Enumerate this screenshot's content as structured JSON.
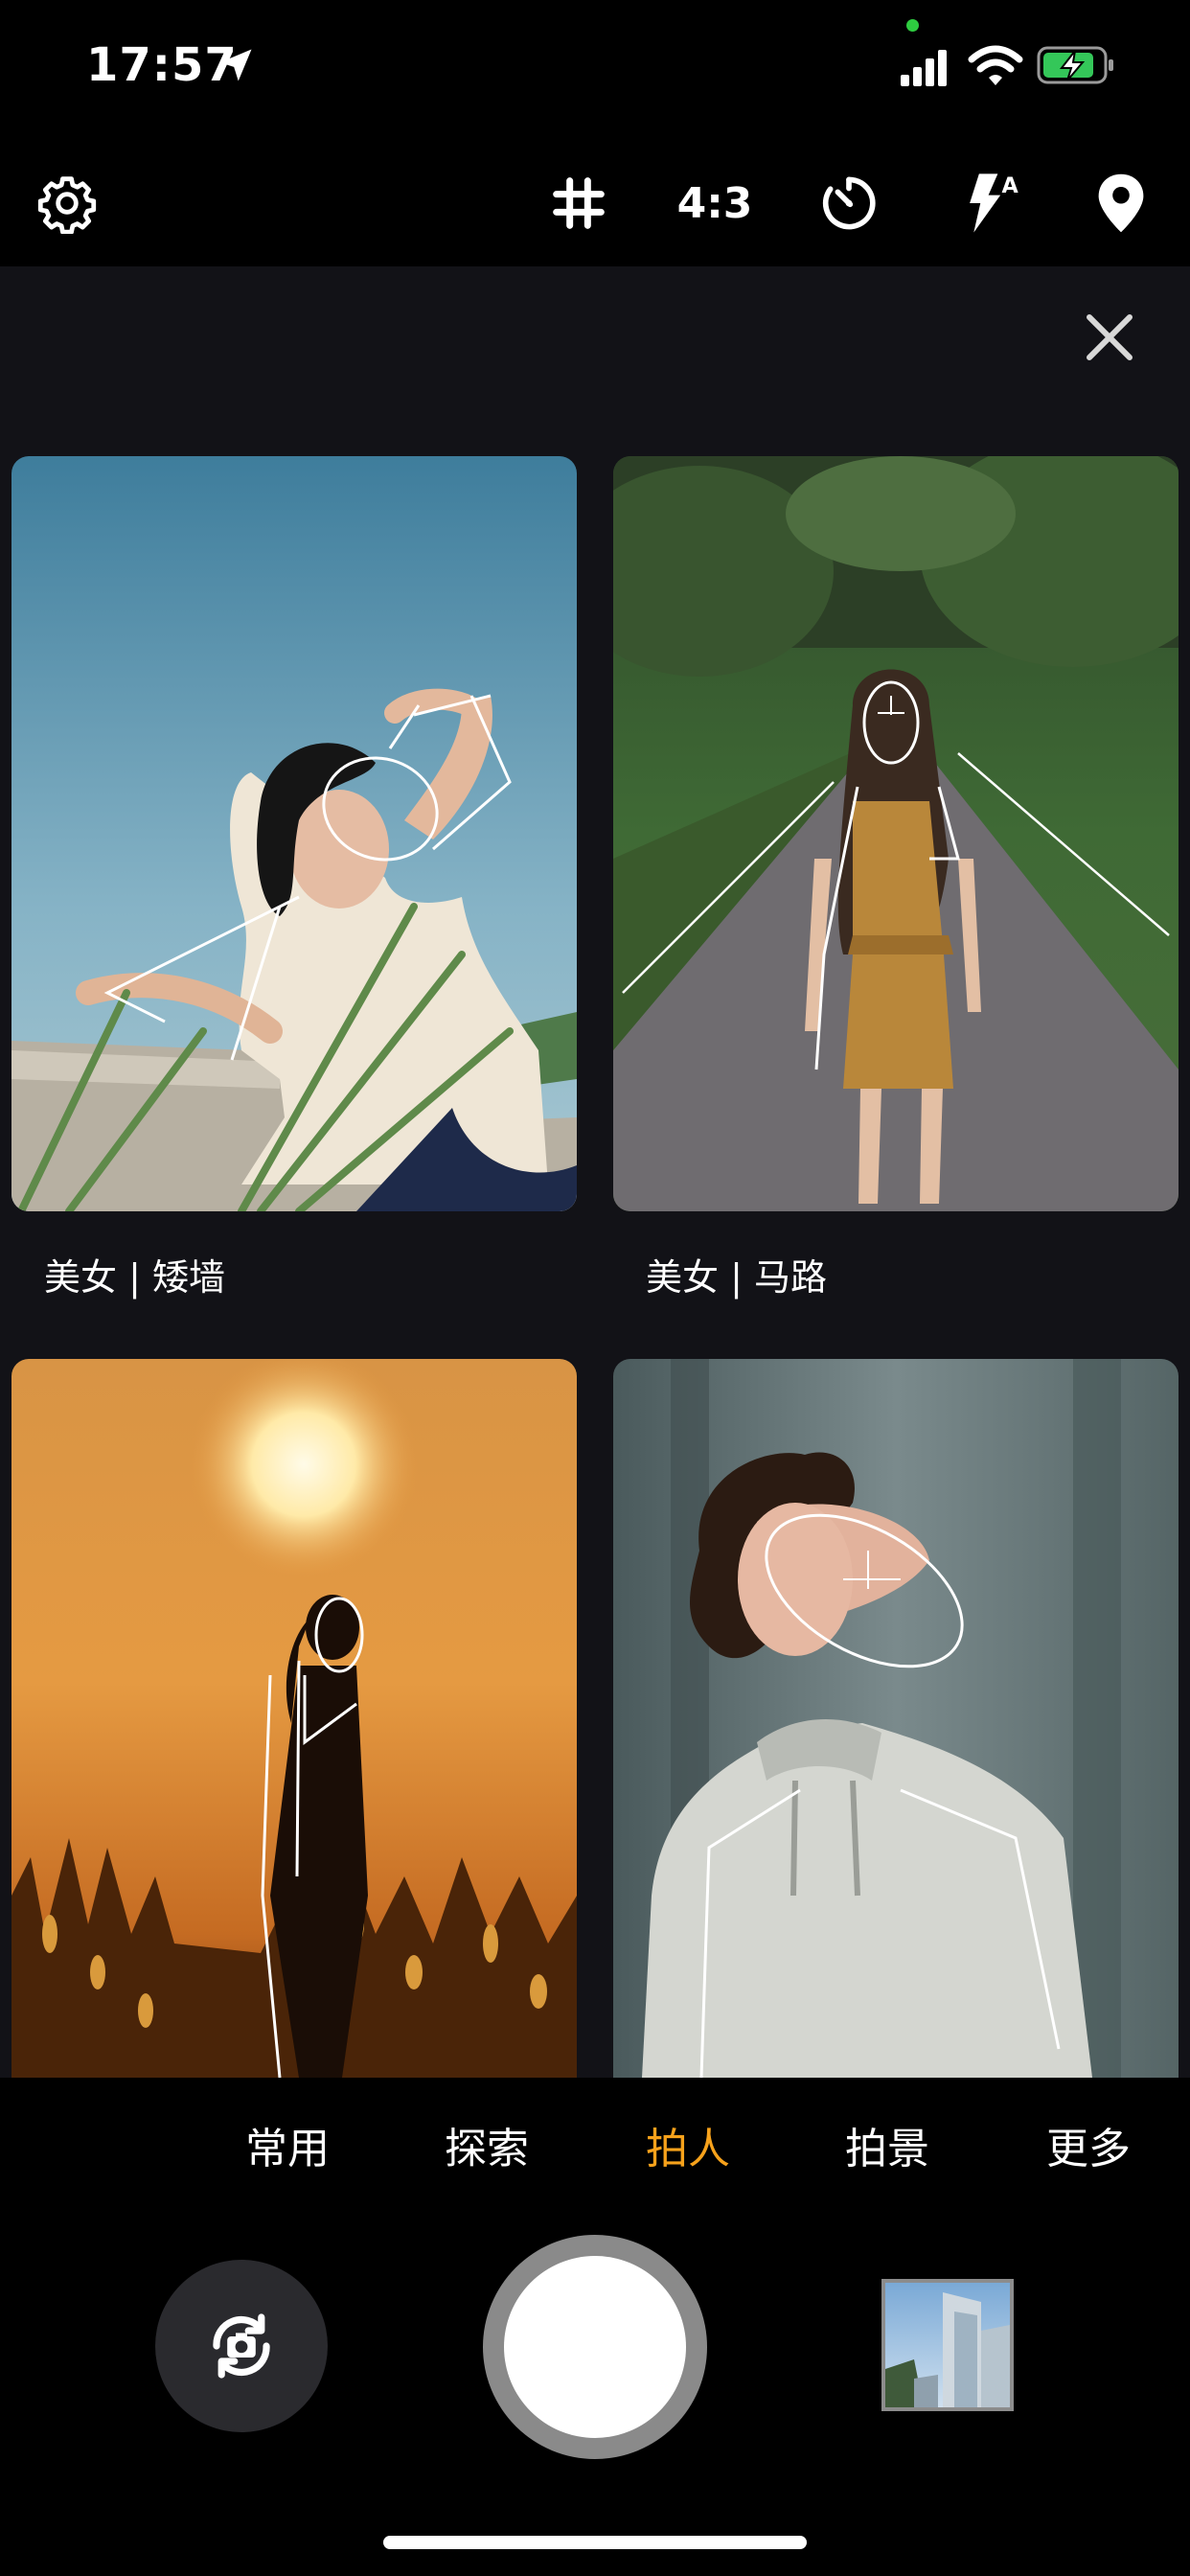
{
  "status_bar": {
    "time": "17:57",
    "icons": [
      "location-arrow-icon",
      "signal-icon",
      "wifi-icon",
      "battery-charging-icon"
    ]
  },
  "toolbar": {
    "settings_icon": "gear-icon",
    "grid_icon": "grid-icon",
    "ratio_label": "4:3",
    "timer_icon": "timer-icon",
    "flash_icon": "flash-auto-icon",
    "location_icon": "location-pin-icon"
  },
  "panel": {
    "close_icon": "close-icon",
    "cards": [
      {
        "label": "美女 | 矮墙"
      },
      {
        "label": "美女 | 马路"
      },
      {
        "label": ""
      },
      {
        "label": ""
      }
    ]
  },
  "modes": {
    "items": [
      "常用",
      "探索",
      "拍人",
      "拍景",
      "更多"
    ],
    "active": "拍人"
  },
  "controls": {
    "flip_icon": "camera-flip-icon",
    "shutter": "shutter-button",
    "gallery": "gallery-thumbnail"
  },
  "colors": {
    "accent": "#f7a21b",
    "panel_bg": "#121217",
    "background": "#000000"
  }
}
